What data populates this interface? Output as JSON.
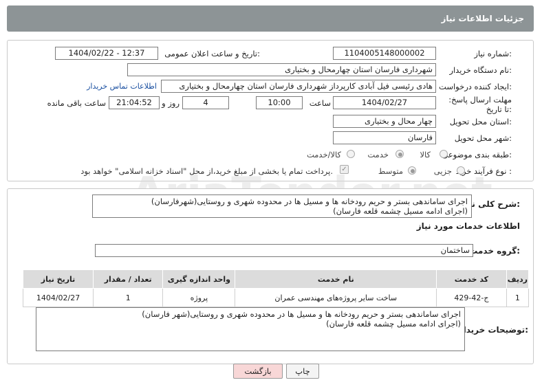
{
  "header": {
    "title": "جزئیات اطلاعات نیاز"
  },
  "fields": {
    "need_number_label": "شماره نیاز:",
    "need_number": "1104005148000002",
    "announce_label": "تاریخ و ساعت اعلان عمومی:",
    "announce_value": "1404/02/22 - 12:37",
    "buyer_org_label": "نام دستگاه خریدار:",
    "buyer_org": "شهرداری فارسان استان چهارمحال و بختیاری",
    "creator_label": "ایجاد کننده درخواست:",
    "creator": "هادی رئیسی فیل آبادی کارپرداز شهرداری فارسان استان چهارمحال و بختیاری",
    "contact_link": "اطلاعات تماس خریدار",
    "deadline_label": "مهلت ارسال پاسخ: تا تاریخ:",
    "deadline_date": "1404/02/27",
    "hour_label": "ساعت",
    "deadline_hour": "10:00",
    "days_value": "4",
    "days_label": "روز و",
    "remaining_time": "21:04:52",
    "remaining_label": "ساعت باقی مانده",
    "province_label": "استان محل تحویل:",
    "province": "چهار محال و بختیاری",
    "city_label": "شهر محل تحویل:",
    "city": "فارسان",
    "category_label": "طبقه بندی موضوعی:",
    "category_options": [
      "کالا",
      "خدمت",
      "کالا/خدمت"
    ],
    "category_selected": "خدمت",
    "process_label": "نوع فرآیند خرید :",
    "process_options": [
      "جزیی",
      "متوسط"
    ],
    "process_selected": "متوسط",
    "payment_note": "پرداخت تمام یا بخشی از مبلغ خرید،از محل \"اسناد خزانه اسلامی\" خواهد بود."
  },
  "description": {
    "label": "شرح کلی نیاز:",
    "lines": [
      "اجرای ساماندهی بستر و حریم رودخانه ها و مسیل ها در محدوده شهری و روستایی(شهرفارسان)",
      "(اجرای ادامه مسیل چشمه قلعه فارسان)"
    ]
  },
  "services": {
    "section_title": "اطلاعات خدمات مورد نیاز",
    "group_label": "گروه خدمت:",
    "group_value": "ساختمان",
    "columns": [
      "ردیف",
      "کد خدمت",
      "نام خدمت",
      "واحد اندازه گیری",
      "تعداد / مقدار",
      "تاریخ نیاز"
    ],
    "rows": [
      [
        "1",
        "ج-42-429",
        "ساخت سایر پروژه‌های مهندسی عمران",
        "پروژه",
        "1",
        "1404/02/27"
      ]
    ]
  },
  "buyer_notes": {
    "label": "توضیحات خریدار:",
    "lines": [
      "اجرای ساماندهی بستر و حریم رودخانه ها و مسیل ها در محدوده شهری و روستایی(شهر فارسان)",
      "(اجرای ادامه مسیل چشمه قلعه فارسان)"
    ]
  },
  "buttons": {
    "print": "چاپ",
    "back": "بازگشت"
  },
  "colors": {
    "header_bg": "#8d9496",
    "back_button_bg": "#f8d7d7",
    "link": "#1a4fa0"
  }
}
